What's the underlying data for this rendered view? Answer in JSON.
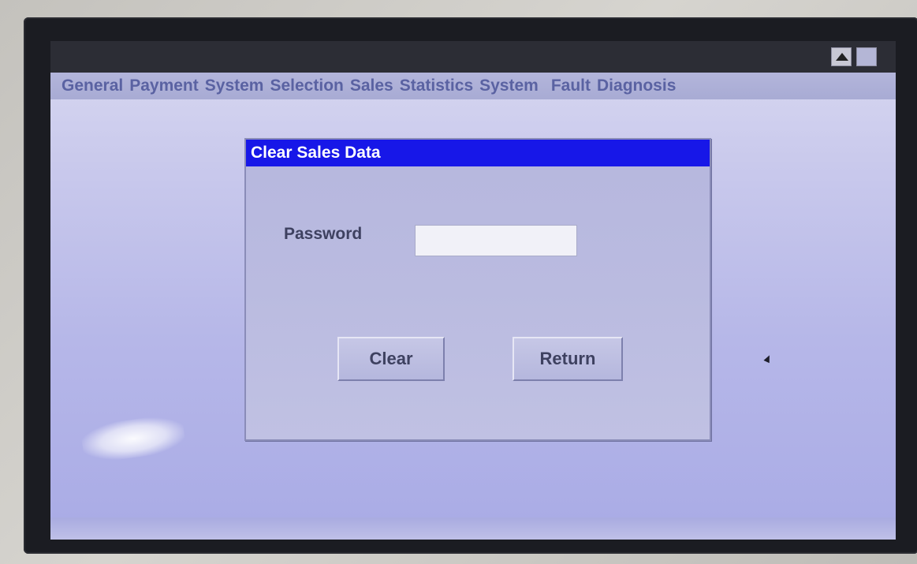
{
  "menu": {
    "items": [
      "General",
      "Payment",
      "System",
      "Selection",
      "Sales",
      "Statistics",
      "System",
      "Fault",
      "Diagnosis"
    ]
  },
  "dialog": {
    "title": "Clear Sales Data",
    "password_label": "Password",
    "password_value": "",
    "clear_label": "Clear",
    "return_label": "Return"
  },
  "colors": {
    "dialog_title_bar": "#1717e8",
    "screen_background": "#b6b7e8",
    "menu_text": "#5a62a2"
  },
  "icons": {
    "scroll_up": "triangle-up-icon",
    "restore": "window-square-icon"
  }
}
